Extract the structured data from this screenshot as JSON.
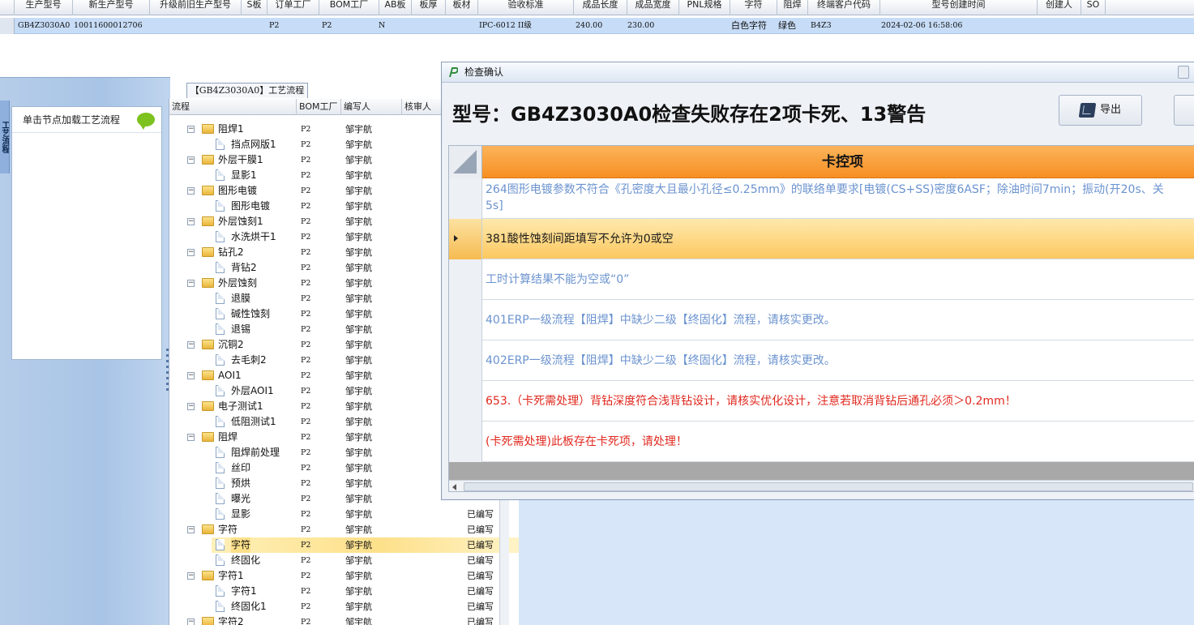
{
  "top_grid": {
    "columns": [
      "生产型号",
      "新生产型号",
      "升级前旧生产型号",
      "S板",
      "订单工厂",
      "BOM工厂",
      "AB板",
      "板厚",
      "板材",
      "验收标准",
      "成品长度",
      "成品宽度",
      "PNL规格",
      "字符",
      "阻焊",
      "终端客户代码",
      "型号创建时间",
      "创建人",
      "SO"
    ],
    "row": [
      "GB4Z3030A0",
      "10011600012706",
      "",
      "",
      "P2",
      "P2",
      "N",
      "",
      "",
      "IPC-6012 II级",
      "240.00",
      "230.00",
      "",
      "白色字符",
      "绿色",
      "B4Z3",
      "2024-02-06 16:58:06",
      "",
      ""
    ]
  },
  "left_panel": {
    "side_tab_label": "工艺流程",
    "node_box_title": "单击节点加载工艺流程"
  },
  "tree": {
    "title": "【GB4Z3030A0】工艺流程",
    "columns": [
      "流程",
      "BOM工厂",
      "编写人",
      "核审人"
    ],
    "rows": [
      {
        "name": "阻焊1",
        "type": "folder",
        "bom": "P2",
        "author": "邹宇航",
        "status": ""
      },
      {
        "name": "挡点网版1",
        "type": "doc",
        "bom": "P2",
        "author": "邹宇航",
        "status": ""
      },
      {
        "name": "外层干膜1",
        "type": "folder",
        "bom": "P2",
        "author": "邹宇航",
        "status": ""
      },
      {
        "name": "显影1",
        "type": "doc",
        "bom": "P2",
        "author": "邹宇航",
        "status": ""
      },
      {
        "name": "图形电镀",
        "type": "folder",
        "bom": "P2",
        "author": "邹宇航",
        "status": ""
      },
      {
        "name": "图形电镀",
        "type": "doc",
        "bom": "P2",
        "author": "邹宇航",
        "status": ""
      },
      {
        "name": "外层蚀刻1",
        "type": "folder",
        "bom": "P2",
        "author": "邹宇航",
        "status": ""
      },
      {
        "name": "水洗烘干1",
        "type": "doc",
        "bom": "P2",
        "author": "邹宇航",
        "status": ""
      },
      {
        "name": "钻孔2",
        "type": "folder",
        "bom": "P2",
        "author": "邹宇航",
        "status": ""
      },
      {
        "name": "背钻2",
        "type": "doc",
        "bom": "P2",
        "author": "邹宇航",
        "status": ""
      },
      {
        "name": "外层蚀刻",
        "type": "folder",
        "bom": "P2",
        "author": "邹宇航",
        "status": ""
      },
      {
        "name": "退膜",
        "type": "doc",
        "bom": "P2",
        "author": "邹宇航",
        "status": ""
      },
      {
        "name": "碱性蚀刻",
        "type": "doc",
        "bom": "P2",
        "author": "邹宇航",
        "status": ""
      },
      {
        "name": "退锡",
        "type": "doc",
        "bom": "P2",
        "author": "邹宇航",
        "status": ""
      },
      {
        "name": "沉铜2",
        "type": "folder",
        "bom": "P2",
        "author": "邹宇航",
        "status": ""
      },
      {
        "name": "去毛刺2",
        "type": "doc",
        "bom": "P2",
        "author": "邹宇航",
        "status": ""
      },
      {
        "name": "AOI1",
        "type": "folder",
        "bom": "P2",
        "author": "邹宇航",
        "status": ""
      },
      {
        "name": "外层AOI1",
        "type": "doc",
        "bom": "P2",
        "author": "邹宇航",
        "status": ""
      },
      {
        "name": "电子测试1",
        "type": "folder",
        "bom": "P2",
        "author": "邹宇航",
        "status": ""
      },
      {
        "name": "低阻测试1",
        "type": "doc",
        "bom": "P2",
        "author": "邹宇航",
        "status": ""
      },
      {
        "name": "阻焊",
        "type": "folder",
        "bom": "P2",
        "author": "邹宇航",
        "status": ""
      },
      {
        "name": "阻焊前处理",
        "type": "doc",
        "bom": "P2",
        "author": "邹宇航",
        "status": ""
      },
      {
        "name": "丝印",
        "type": "doc",
        "bom": "P2",
        "author": "邹宇航",
        "status": ""
      },
      {
        "name": "预烘",
        "type": "doc",
        "bom": "P2",
        "author": "邹宇航",
        "status": ""
      },
      {
        "name": "曝光",
        "type": "doc",
        "bom": "P2",
        "author": "邹宇航",
        "status": ""
      },
      {
        "name": "显影",
        "type": "doc",
        "bom": "P2",
        "author": "邹宇航",
        "status": "已编写"
      },
      {
        "name": "字符",
        "type": "folder",
        "bom": "P2",
        "author": "邹宇航",
        "status": "已编写"
      },
      {
        "name": "字符",
        "type": "doc",
        "bom": "P2",
        "author": "邹宇航",
        "status": "已编写",
        "selected": true
      },
      {
        "name": "终固化",
        "type": "doc",
        "bom": "P2",
        "author": "邹宇航",
        "status": "已编写"
      },
      {
        "name": "字符1",
        "type": "folder",
        "bom": "P2",
        "author": "邹宇航",
        "status": "已编写"
      },
      {
        "name": "字符1",
        "type": "doc",
        "bom": "P2",
        "author": "邹宇航",
        "status": "已编写"
      },
      {
        "name": "终固化1",
        "type": "doc",
        "bom": "P2",
        "author": "邹宇航",
        "status": "已编写"
      },
      {
        "name": "字符2",
        "type": "folder",
        "bom": "P2",
        "author": "邹宇航",
        "status": "已编写"
      }
    ]
  },
  "dialog": {
    "title": "检查确认",
    "heading": "型号：GB4Z3030A0检查失败存在2项卡死、13警告",
    "export_label": "导出",
    "grid_header": "卡控项",
    "items": [
      {
        "text": "264图形电镀参数不符合《孔密度大且最小孔径≤0.25mm》的联络单要求[电镀(CS+SS)密度6ASF；除油时间7min；振动(开20s、关",
        "text2": "5s]",
        "color": "#6b93cf"
      },
      {
        "text": "381酸性蚀刻间距填写不允许为0或空",
        "color": "#1a1a1a",
        "selected": true
      },
      {
        "text": "工时计算结果不能为空或“0”",
        "color": "#6b93cf"
      },
      {
        "text": "401ERP一级流程【阻焊】中缺少二级【终固化】流程，请核实更改。",
        "color": "#6b93cf"
      },
      {
        "text": "402ERP一级流程【阻焊】中缺少二级【终固化】流程，请核实更改。",
        "color": "#6b93cf"
      },
      {
        "text": "653.（卡死需处理）背钻深度符合浅背钻设计，请核实优化设计，注意若取消背钻后通孔必须＞0.2mm！",
        "color": "#e0281e"
      },
      {
        "text": "(卡死需处理)此板存在卡死项，请处理！",
        "color": "#e0281e"
      }
    ]
  },
  "colors": {
    "header_orange": "#f89a30",
    "selected_row": "#fcc860",
    "warning_blue": "#6b93cf",
    "error_red": "#e0281e",
    "grid_selection": "#c7dcf6"
  }
}
